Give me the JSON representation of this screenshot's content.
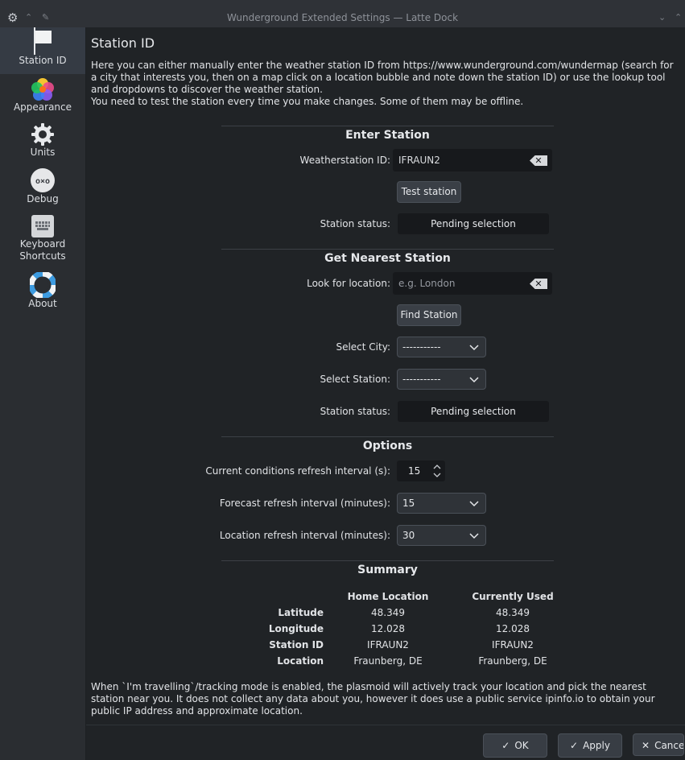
{
  "window": {
    "title": "Wunderground Extended Settings — Latte Dock"
  },
  "sidebar": {
    "items": [
      {
        "label": "Station ID",
        "icon": "flag-icon"
      },
      {
        "label": "Appearance",
        "icon": "appearance-icon"
      },
      {
        "label": "Units",
        "icon": "gear-icon"
      },
      {
        "label": "Debug",
        "icon": "debug-icon"
      },
      {
        "label": "Keyboard Shortcuts",
        "icon": "keyboard-icon"
      },
      {
        "label": "About",
        "icon": "lifebuoy-icon"
      }
    ]
  },
  "page": {
    "title": "Station ID",
    "intro_line1": "Here you can either manually enter the weather station ID from https://www.wunderground.com/wundermap (search for a city that interests you, then on a map click on a location bubble and note down the station ID) or use the lookup tool and dropdowns to discover the weather station.",
    "intro_line2": "You need to test the station every time you make changes. Some of them may be offline."
  },
  "enter_station": {
    "title": "Enter Station",
    "id_label": "Weatherstation ID:",
    "id_value": "IFRAUN2",
    "test_button": "Test station",
    "status_label": "Station status:",
    "status_value": "Pending selection"
  },
  "nearest_station": {
    "title": "Get Nearest Station",
    "location_label": "Look for location:",
    "location_placeholder": "e.g. London",
    "find_button": "Find Station",
    "city_label": "Select City:",
    "city_value": "-----------",
    "station_label": "Select Station:",
    "station_value": "-----------",
    "status_label": "Station status:",
    "status_value": "Pending selection"
  },
  "options": {
    "title": "Options",
    "current_label": "Current conditions refresh interval (s):",
    "current_value": "15",
    "forecast_label": "Forecast refresh interval (minutes):",
    "forecast_value": "15",
    "location_label": "Location refresh interval (minutes):",
    "location_value": "30"
  },
  "summary": {
    "title": "Summary",
    "col_home": "Home Location",
    "col_current": "Currently Used",
    "rows": [
      {
        "label": "Latitude",
        "home": "48.349",
        "current": "48.349"
      },
      {
        "label": "Longitude",
        "home": "12.028",
        "current": "12.028"
      },
      {
        "label": "Station ID",
        "home": "IFRAUN2",
        "current": "IFRAUN2"
      },
      {
        "label": "Location",
        "home": "Fraunberg, DE",
        "current": "Fraunberg, DE"
      }
    ]
  },
  "notice": "When `I'm travelling`/tracking mode is enabled, the plasmoid will actively track your location and pick the nearest station near you. It does not collect any data about you, however it does use a public service ipinfo.io to obtain your public IP address and approximate location.",
  "footer": {
    "ok": "OK",
    "apply": "Apply",
    "cancel": "Cancel"
  }
}
